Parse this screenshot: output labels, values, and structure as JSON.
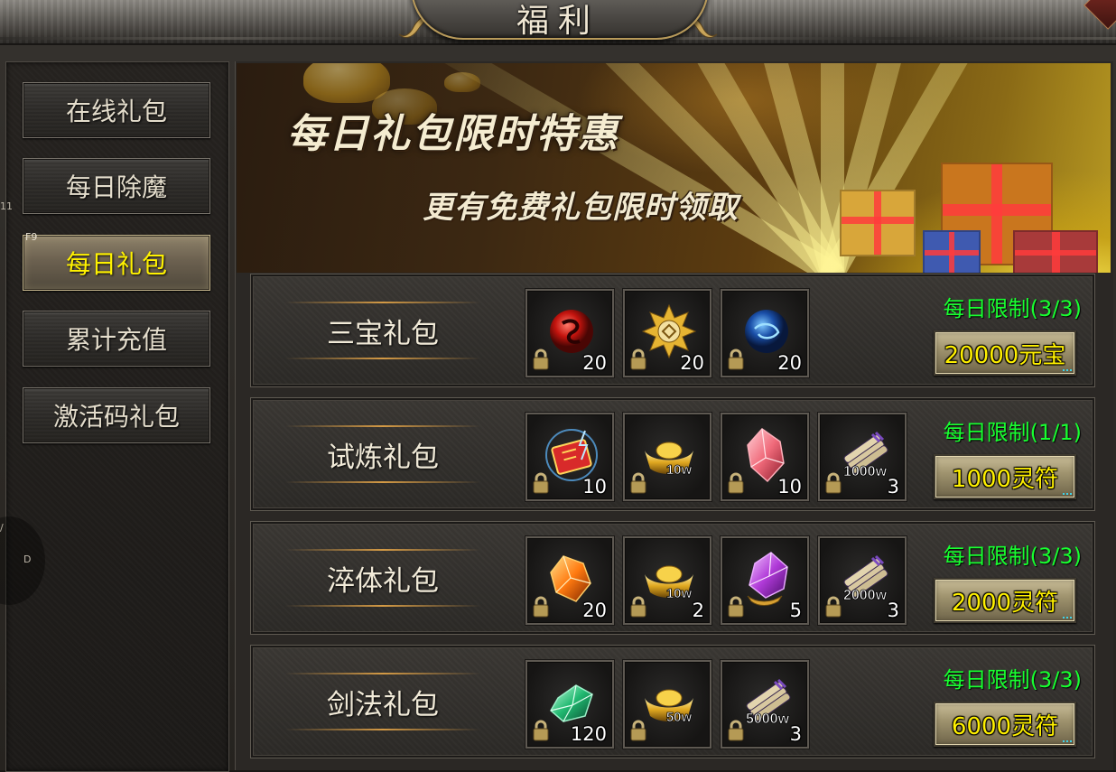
{
  "window": {
    "title": "福利"
  },
  "left_edge_fragments": {
    "top": "11",
    "mid": "/",
    "bottom": "D"
  },
  "sidebar": {
    "hotkey_badge": "F9",
    "items": [
      {
        "label": "在线礼包",
        "active": false
      },
      {
        "label": "每日除魔",
        "active": false
      },
      {
        "label": "每日礼包",
        "active": true
      },
      {
        "label": "累计充值",
        "active": false
      },
      {
        "label": "激活码礼包",
        "active": false
      }
    ]
  },
  "banner": {
    "title": "每日礼包限时特惠",
    "subtitle": "更有免费礼包限时领取"
  },
  "packs": [
    {
      "name": "三宝礼包",
      "limit": "每日限制(3/3)",
      "price": "20000元宝",
      "items": [
        {
          "icon": "red-dragon-orb-icon",
          "qty": "20"
        },
        {
          "icon": "gold-medallion-icon",
          "qty": "20"
        },
        {
          "icon": "blue-orb-icon",
          "qty": "20"
        }
      ]
    },
    {
      "name": "试炼礼包",
      "limit": "每日限制(1/1)",
      "price": "1000灵符",
      "items": [
        {
          "icon": "lightning-card-icon",
          "qty": "10"
        },
        {
          "icon": "gold-ingot-icon",
          "overlay": "10w",
          "qty": ""
        },
        {
          "icon": "pink-crystal-icon",
          "qty": "10"
        },
        {
          "icon": "scroll-bundle-icon",
          "overlay": "1000w",
          "qty": "3"
        }
      ]
    },
    {
      "name": "淬体礼包",
      "limit": "每日限制(3/3)",
      "price": "2000灵符",
      "items": [
        {
          "icon": "orange-gem-icon",
          "qty": "20"
        },
        {
          "icon": "gold-ingot-icon",
          "overlay": "10w",
          "qty": "2"
        },
        {
          "icon": "purple-gem-icon",
          "qty": "5"
        },
        {
          "icon": "scroll-bundle-icon",
          "overlay": "2000w",
          "qty": "3"
        }
      ]
    },
    {
      "name": "剑法礼包",
      "limit": "每日限制(3/3)",
      "price": "6000灵符",
      "items": [
        {
          "icon": "green-gem-icon",
          "qty": "120"
        },
        {
          "icon": "gold-ingot-icon",
          "overlay": "50w",
          "qty": ""
        },
        {
          "icon": "scroll-bundle-icon",
          "overlay": "5000w",
          "qty": "3"
        }
      ]
    }
  ],
  "colors": {
    "limit_text": "#18ff30",
    "price_text": "#fff000",
    "active_tab_text": "#fff200"
  }
}
